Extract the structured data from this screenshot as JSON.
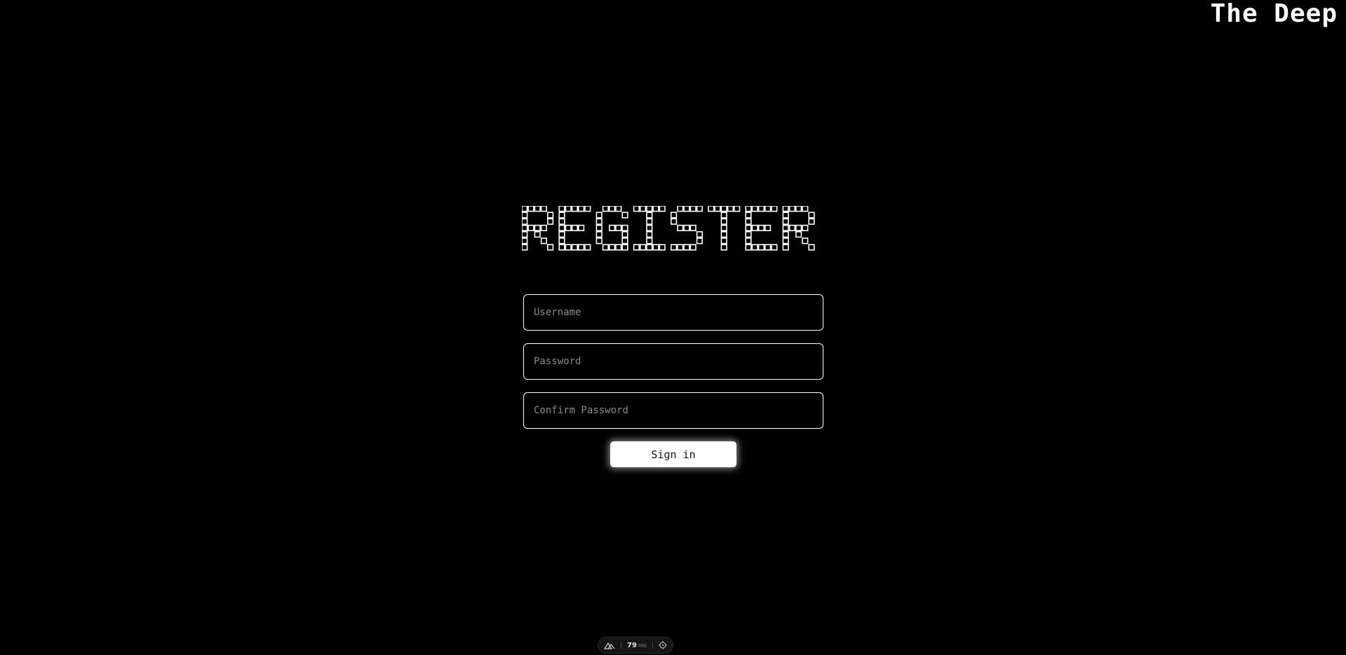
{
  "header": {
    "brand": "The Deep"
  },
  "main": {
    "heading": "REGISTER",
    "form": {
      "username_placeholder": "Username",
      "password_placeholder": "Password",
      "confirm_password_placeholder": "Confirm Password",
      "username_value": "",
      "password_value": "",
      "confirm_password_value": "",
      "submit_label": "Sign in"
    }
  },
  "devtools": {
    "logo_icon": "nuxt-logo-icon",
    "render_time": "79",
    "render_unit": "ms",
    "inspect_icon": "crosshair-icon"
  },
  "colors": {
    "background": "#000000",
    "foreground": "#ffffff",
    "placeholder": "#8a8a8a"
  }
}
